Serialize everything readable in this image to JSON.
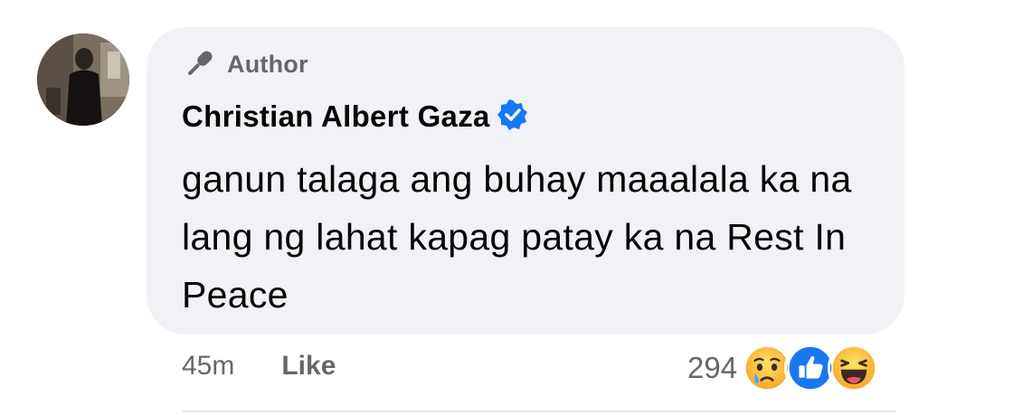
{
  "comment": {
    "author_badge": "Author",
    "name": "Christian Albert Gaza",
    "text": "ganun talaga ang buhay maaalala ka na lang ng lahat kapag patay ka na Rest In Peace",
    "time": "45m",
    "like_label": "Like",
    "reaction_count": "294",
    "reactions": [
      "sad",
      "like",
      "haha"
    ]
  },
  "colors": {
    "bubble": "#f0f2f5",
    "verified": "#1877f2",
    "secondary_text": "#65676b",
    "like_blue": "#1877f2"
  }
}
